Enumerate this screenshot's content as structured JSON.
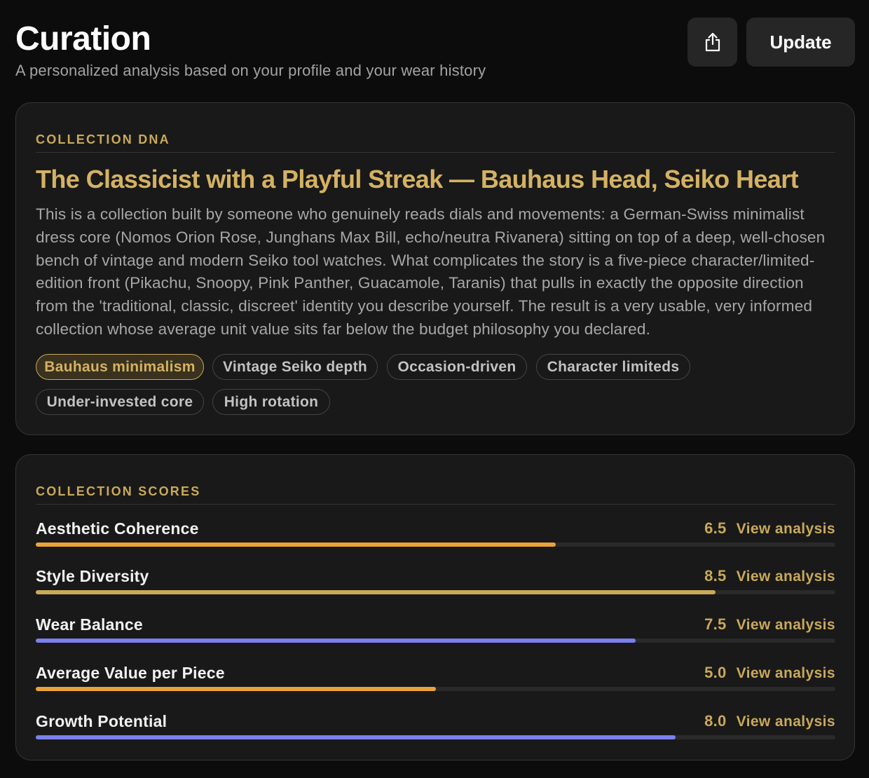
{
  "header": {
    "title": "Curation",
    "subtitle": "A personalized analysis based on your profile and your wear history",
    "share_icon": "share-upload-icon",
    "update_label": "Update"
  },
  "dna": {
    "label": "COLLECTION DNA",
    "headline": "The Classicist with a Playful Streak — Bauhaus Head, Seiko Heart",
    "body": "This is a collection built by someone who genuinely reads dials and movements: a German-Swiss minimalist dress core (Nomos Orion Rose, Junghans Max Bill, echo/neutra Rivanera) sitting on top of a deep, well-chosen bench of vintage and modern Seiko tool watches. What complicates the story is a five-piece character/limited-edition front (Pikachu, Snoopy, Pink Panther, Guacamole, Taranis) that pulls in exactly the opposite direction from the 'traditional, classic, discreet' identity you describe yourself. The result is a very usable, very informed collection whose average unit value sits far below the budget philosophy you declared.",
    "tags": [
      {
        "label": "Bauhaus minimalism",
        "active": true
      },
      {
        "label": "Vintage Seiko depth",
        "active": false
      },
      {
        "label": "Occasion-driven",
        "active": false
      },
      {
        "label": "Character limiteds",
        "active": false
      },
      {
        "label": "Under-invested core",
        "active": false
      },
      {
        "label": "High rotation",
        "active": false
      }
    ]
  },
  "scores": {
    "label": "COLLECTION SCORES",
    "link_label": "View analysis",
    "items": [
      {
        "name": "Aesthetic Coherence",
        "value": "6.5",
        "score": 6.5,
        "color": "#eaa33b"
      },
      {
        "name": "Style Diversity",
        "value": "8.5",
        "score": 8.5,
        "color": "#c9a95a"
      },
      {
        "name": "Wear Balance",
        "value": "7.5",
        "score": 7.5,
        "color": "#7b80ec"
      },
      {
        "name": "Average Value per Piece",
        "value": "5.0",
        "score": 5.0,
        "color": "#eaa33b"
      },
      {
        "name": "Growth Potential",
        "value": "8.0",
        "score": 8.0,
        "color": "#7b80ec"
      }
    ],
    "max_score": 10
  },
  "colors": {
    "accent_gold": "#c9a95a",
    "background": "#0c0c0c",
    "card": "#191919"
  }
}
